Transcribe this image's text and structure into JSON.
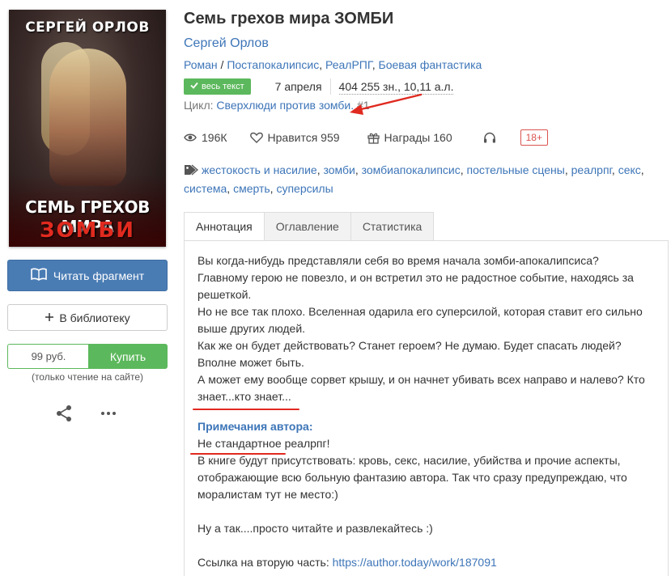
{
  "cover": {
    "author": "СЕРГЕЙ ОРЛОВ",
    "title_line1": "СЕМЬ ГРЕХОВ МИРА",
    "title_line2": "ЗОМБИ"
  },
  "sidebar": {
    "read_fragment_label": "Читать фрагмент",
    "add_library_label": "В библиотеку",
    "price": "99 руб.",
    "buy_label": "Купить",
    "read_note": "(только чтение на сайте)"
  },
  "book": {
    "title": "Семь грехов мира ЗОМБИ",
    "author": "Сергей Орлов",
    "genres": [
      "Роман",
      "Постапокалипсис",
      "РеалРПГ",
      "Боевая фантастика"
    ],
    "full_text_badge": "весь текст",
    "date": "7 апреля",
    "size": "404 255 зн., 10,11 а.л.",
    "cycle_label": "Цикл:",
    "cycle_name": "Сверхлюди против зомби.",
    "cycle_number": "#1"
  },
  "stats": {
    "views": "196К",
    "likes": "Нравится 959",
    "awards": "Награды 160",
    "age": "18+"
  },
  "tags": [
    "жестокость и насилие",
    "зомби",
    "зомбиапокалипсис",
    "постельные сцены",
    "реалрпг",
    "секс",
    "система",
    "смерть",
    "суперсилы"
  ],
  "tabs": [
    "Аннотация",
    "Оглавление",
    "Статистика"
  ],
  "annotation": {
    "lines": [
      "Вы когда-нибудь представляли себя во время начала зомби-апокалипсиса?",
      "Главному герою не повезло, и он встретил это не радостное событие, находясь за",
      "решеткой.",
      "Но не все так плохо. Вселенная одарила его суперсилой, которая ставит его сильно",
      "выше других людей.",
      "Как же он будет действовать? Станет героем? Не думаю. Будет спасать людей?",
      "Вполне может быть.",
      "А может ему вообще сорвет крышу, и он начнет убивать всех направо и налево? Кто",
      "знает...кто знает..."
    ],
    "notes_heading": "Примечания автора:",
    "notes_lines": [
      "Не стандартное реалрпг!",
      "В книге будут присутствовать: кровь, секс, насилие, убийства и прочие аспекты,",
      "отображающие всю больную фантазию автора. Так что сразу предупреждаю, что",
      "моралистам тут не место:)"
    ],
    "closing": "Ну а так....просто читайте и развлекайтесь :)",
    "link_prefix": "Ссылка на вторую часть: ",
    "link_url": "https://author.today/work/187091"
  },
  "colors": {
    "link": "#3d75b8",
    "read_button": "#4a7cb4",
    "buy_button": "#5cb85c",
    "annotation_red": "#e02a20",
    "age_badge": "#d9534f"
  }
}
